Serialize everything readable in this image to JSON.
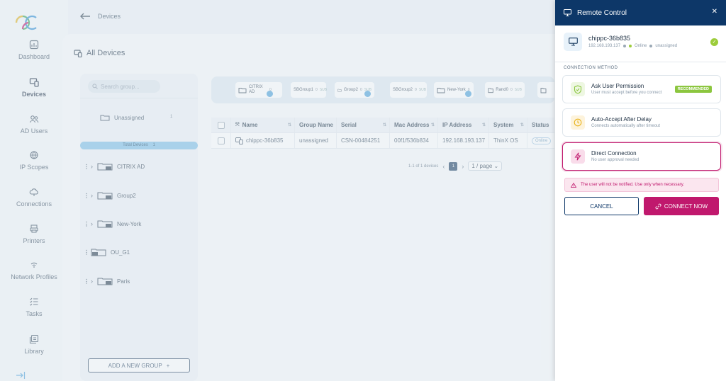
{
  "nav": {
    "items": [
      {
        "label": "Dashboard",
        "icon": "dashboard-icon"
      },
      {
        "label": "Devices",
        "icon": "devices-icon"
      },
      {
        "label": "AD Users",
        "icon": "users-icon"
      },
      {
        "label": "IP Scopes",
        "icon": "globe-icon"
      },
      {
        "label": "Connections",
        "icon": "cloud-icon"
      },
      {
        "label": "Printers",
        "icon": "printer-icon"
      },
      {
        "label": "Network Profiles",
        "icon": "wifi-icon"
      },
      {
        "label": "Tasks",
        "icon": "tasks-icon"
      },
      {
        "label": "Library",
        "icon": "library-icon"
      }
    ],
    "active": "Devices"
  },
  "header": {
    "back_label": "Devices",
    "page_title": "All Devices"
  },
  "groups": {
    "search_placeholder": "Search group...",
    "unassigned_label": "Unassigned",
    "unassigned_count": "1",
    "total_label": "Total Devices",
    "total_count": "1",
    "tree": [
      {
        "label": "CITRIX AD",
        "expandable": true
      },
      {
        "label": "Group2",
        "expandable": true
      },
      {
        "label": "New-York",
        "expandable": true
      },
      {
        "label": "OU_G1",
        "expandable": false
      },
      {
        "label": "Paris",
        "expandable": true
      }
    ],
    "add_group_label": "ADD A NEW GROUP"
  },
  "chips": [
    {
      "label": "CITRIX AD",
      "count": "0",
      "sub": ""
    },
    {
      "label": "SBGroup1",
      "count": "0",
      "sub": "SUB"
    },
    {
      "label": "Group2",
      "count": "0",
      "sub": "SUB"
    },
    {
      "label": "SBGroup2",
      "count": "0",
      "sub": "SUB"
    },
    {
      "label": "New-York",
      "count": "0",
      "sub": ""
    },
    {
      "label": "Rand0",
      "count": "0",
      "sub": "SUB"
    }
  ],
  "table": {
    "columns": [
      "Name",
      "Group Name",
      "Serial",
      "Mac Address",
      "IP Address",
      "System",
      "Status"
    ],
    "rows": [
      [
        "chippc-36b835",
        "unassigned",
        "CSN-00484251",
        "00f1f536b834",
        "192.168.193.137",
        "ThinX OS",
        "Online"
      ]
    ]
  },
  "pager": {
    "range": "1-1 of 1 devices",
    "page": "1",
    "per_page": "1 / page"
  },
  "drawer": {
    "title": "Remote Control",
    "device_name": "chippc-36b835",
    "device_ip": "192.168.193.137",
    "device_status": "Online",
    "device_group": "unassigned",
    "section_label": "CONNECTION METHOD",
    "methods": [
      {
        "title": "Ask User Permission",
        "desc": "User must accept before you connect",
        "badge": "RECOMMENDED"
      },
      {
        "title": "Auto-Accept After Delay",
        "desc": "Connects automatically after timeout",
        "badge": ""
      },
      {
        "title": "Direct Connection",
        "desc": "No user approval needed",
        "badge": ""
      }
    ],
    "selected_method": "Direct Connection",
    "warning": "The user will not be notified. Use only when necessary.",
    "cancel_label": "CANCEL",
    "connect_label": "CONNECT NOW"
  },
  "colors": {
    "brand_dark": "#0d3768",
    "accent_magenta": "#c0186d",
    "online_green": "#9ccc3a",
    "recommended_green": "#8cc63f"
  }
}
